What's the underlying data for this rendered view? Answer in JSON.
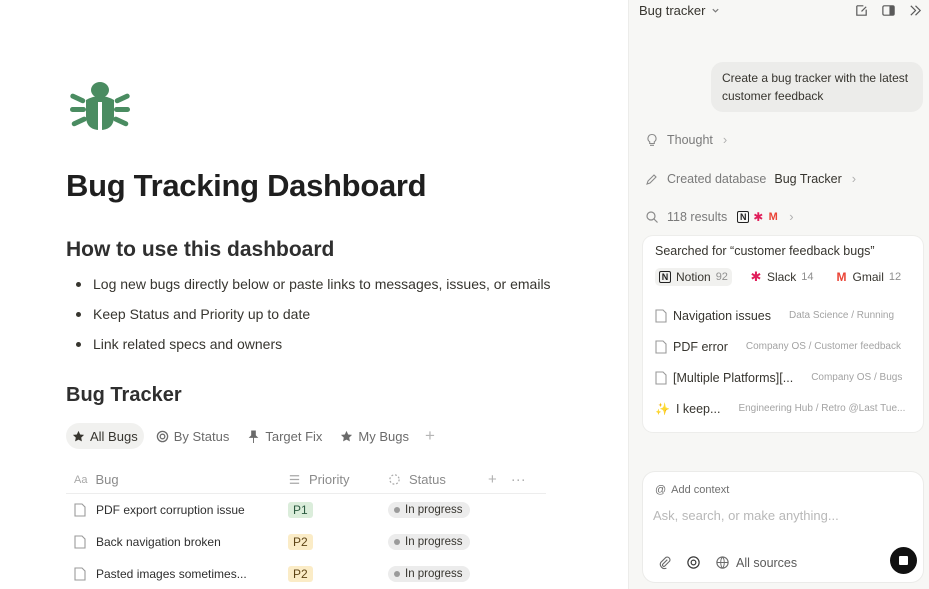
{
  "colors": {
    "bug_icon": "#4a8c61",
    "p1_bg": "#dbeddb",
    "p2_bg": "#fbecc7",
    "panel_bg": "#f7f7f5",
    "slack": "#e01e5a",
    "gmail": "#ea4335"
  },
  "page": {
    "icon": "bug-icon",
    "title": "Bug Tracking Dashboard",
    "howto_heading": "How to use this dashboard",
    "bullets": [
      "Log new bugs directly below or paste links to messages, issues, or emails",
      "Keep Status and Priority up to date",
      "Link related specs and owners"
    ],
    "db_title": "Bug Tracker",
    "views": [
      {
        "label": "All Bugs",
        "icon": "star-icon"
      },
      {
        "label": "By Status",
        "icon": "target-icon"
      },
      {
        "label": "Target Fix",
        "icon": "pin-icon"
      },
      {
        "label": "My Bugs",
        "icon": "star-icon"
      }
    ],
    "columns": {
      "bug": "Bug",
      "bug_prefix": "Aa",
      "priority": "Priority",
      "status": "Status"
    },
    "rows": [
      {
        "bug": "PDF export corruption issue",
        "priority": "P1",
        "status": "In progress"
      },
      {
        "bug": "Back navigation broken",
        "priority": "P2",
        "status": "In progress"
      },
      {
        "bug": "Pasted images sometimes...",
        "priority": "P2",
        "status": "In progress"
      }
    ]
  },
  "panel": {
    "title": "Bug tracker",
    "user_message": "Create a bug tracker with the latest customer feedback",
    "thought_label": "Thought",
    "created_label": "Created database",
    "created_name": "Bug Tracker",
    "results_label": "118 results",
    "searched_text": "Searched for “customer feedback bugs”",
    "sources": [
      {
        "name": "Notion",
        "count": "92",
        "icon": "notion-icon"
      },
      {
        "name": "Slack",
        "count": "14",
        "icon": "slack-icon"
      },
      {
        "name": "Gmail",
        "count": "12",
        "icon": "gmail-icon"
      }
    ],
    "results": [
      {
        "title": "Navigation issues",
        "path": "Data Science / Running",
        "icon": "page-icon"
      },
      {
        "title": "PDF error",
        "path": "Company OS / Customer feedback",
        "icon": "page-icon"
      },
      {
        "title": "[Multiple Platforms][...",
        "path": "Company OS / Bugs",
        "icon": "page-icon"
      },
      {
        "title": "I keep...",
        "path": "Engineering Hub / Retro @Last Tue...",
        "icon": "sparkle-icon"
      }
    ],
    "add_context": "Add context",
    "placeholder": "Ask, search, or make anything...",
    "all_sources": "All sources"
  }
}
